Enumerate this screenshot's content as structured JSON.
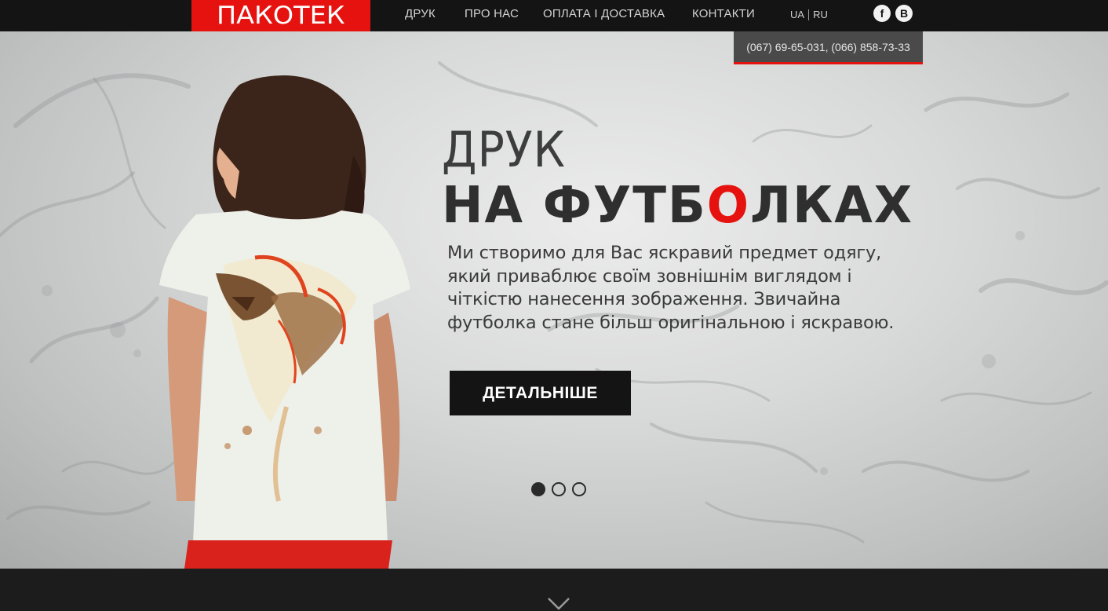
{
  "header": {
    "logo": "ПАКОТЕК",
    "nav": [
      "ДРУК",
      "ПРО НАС",
      "ОПЛАТА І ДОСТАВКА",
      "КОНТАКТИ"
    ],
    "lang": {
      "ua": "UA",
      "ru": "RU"
    },
    "social": {
      "facebook": "f",
      "vk": "B"
    }
  },
  "contacts": {
    "phones": "(067) 69-65-031,  (066) 858-73-33"
  },
  "hero": {
    "headline1": "ДРУК",
    "headline2_a": "НА ФУТБ",
    "headline2_accent": "О",
    "headline2_b": "ЛКАХ",
    "description": "Ми створимо для Вас яскравий предмет одягу, який приваблює своїм зовнішнім виглядом і чіткістю нанесення зображення. Звичайна футболка стане більш оригінальною і яскравою.",
    "cta": "ДЕТАЛЬНІШЕ",
    "slides": 3,
    "active_slide": 1
  },
  "colors": {
    "accent": "#e5120f",
    "dark": "#141414"
  },
  "icons": [
    "facebook-icon",
    "vk-icon",
    "chevron-down-icon"
  ]
}
